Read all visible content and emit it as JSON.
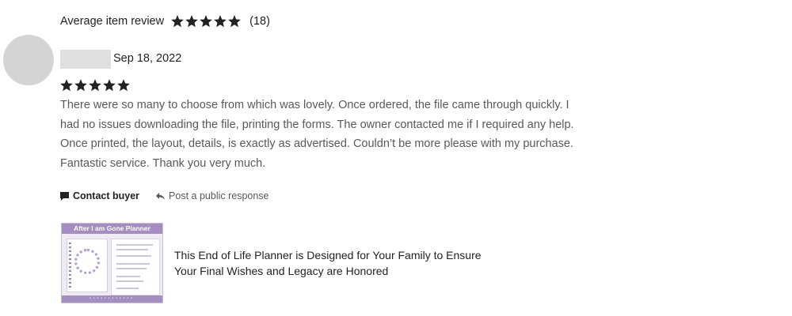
{
  "summary": {
    "label": "Average item review",
    "rating": 5,
    "max_rating": 5,
    "count": "(18)"
  },
  "review": {
    "date": "Sep 18, 2022",
    "rating": 5,
    "text_lines": [
      "There were so many to choose from which was lovely. Once ordered, the file came through quickly. I",
      "had no issues downloading the file, printing the forms. The owner contacted me if I required any help.",
      "Once printed, the layout, details, is exactly as advertised. Couldn’t be more please with my purchase.",
      "Fantastic service. Thank you very much."
    ]
  },
  "actions": {
    "contact_label": "Contact buyer",
    "contact_icon": "chat-bubble-icon",
    "respond_label": "Post a public response",
    "respond_icon": "reply-arrow-icon"
  },
  "listing": {
    "thumbnail_header": "After I am Gone Planner",
    "title_lines": [
      "This End of Life Planner is Designed for Your Family to Ensure",
      "Your Final Wishes and Legacy are Honored"
    ]
  },
  "colors": {
    "star": "#222222",
    "muted_text": "#595959",
    "avatar": "#d4d4d4",
    "thumbnail_accent": "#a58dc0"
  }
}
